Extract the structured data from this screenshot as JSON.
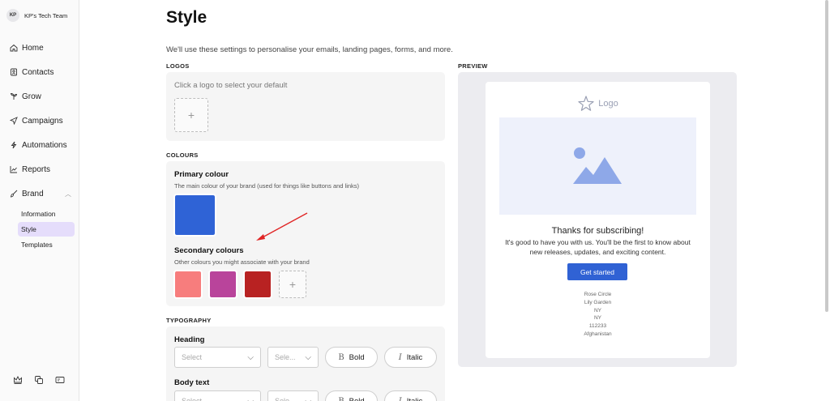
{
  "sidebar": {
    "team": {
      "initials": "KP",
      "name": "KP's Tech Team"
    },
    "items": [
      {
        "label": "Home",
        "icon": "home-icon"
      },
      {
        "label": "Contacts",
        "icon": "contacts-icon"
      },
      {
        "label": "Grow",
        "icon": "grow-icon"
      },
      {
        "label": "Campaigns",
        "icon": "send-icon"
      },
      {
        "label": "Automations",
        "icon": "bolt-icon"
      },
      {
        "label": "Reports",
        "icon": "chart-icon"
      },
      {
        "label": "Brand",
        "icon": "brush-icon"
      }
    ],
    "brand_sub": [
      {
        "label": "Information"
      },
      {
        "label": "Style",
        "active": true
      },
      {
        "label": "Templates"
      }
    ],
    "bottom_icons": [
      "crown-icon",
      "copy-icon",
      "card-icon"
    ]
  },
  "page": {
    "title": "Style",
    "description": "We'll use these settings to personalise your emails, landing pages, forms, and more."
  },
  "logos": {
    "label": "LOGOS",
    "hint": "Click a logo to select your default",
    "add": "+"
  },
  "colours": {
    "label": "COLOURS",
    "primary_title": "Primary colour",
    "primary_desc": "The main colour of your brand (used for things like buttons and links)",
    "primary_color": "#2f63d6",
    "secondary_title": "Secondary colours",
    "secondary_desc": "Other colours you might associate with your brand",
    "secondary_colors": [
      "#f77d7d",
      "#b9449b",
      "#b82222"
    ],
    "add": "+"
  },
  "typography": {
    "label": "TYPOGRAPHY",
    "heading_title": "Heading",
    "body_title": "Body text",
    "select_placeholder": "Select",
    "size_placeholder": "Sele...",
    "bold_label": "Bold",
    "italic_label": "Italic"
  },
  "preview": {
    "label": "PREVIEW",
    "logo_text": "Logo",
    "heading": "Thanks for subscribing!",
    "body": "It's good to have you with us. You'll be the first to know about new releases, updates, and exciting content.",
    "button": "Get started",
    "address": [
      "Rose Circle",
      "Lily Garden",
      "NY",
      "NY",
      "112233",
      "Afghanistan"
    ],
    "button_color": "#3062d4"
  }
}
